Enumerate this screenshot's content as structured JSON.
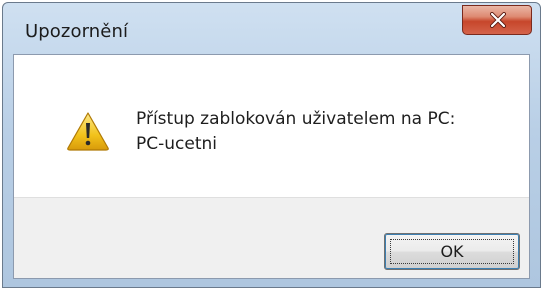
{
  "window": {
    "title": "Upozornění",
    "close_icon": "close-icon"
  },
  "dialog": {
    "icon": "warning-icon",
    "message_line1": "Přístup zablokován uživatelem na PC:",
    "message_line2": "PC-ucetni"
  },
  "buttons": {
    "ok_label": "OK"
  },
  "colors": {
    "title_bar": "#b9cfe6",
    "close_button": "#c7462b",
    "footer": "#f0f0f0",
    "warning_yellow": "#f2c21b"
  }
}
